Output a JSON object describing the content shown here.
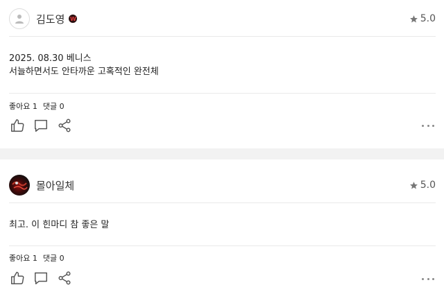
{
  "reviews": [
    {
      "username": "김도영",
      "badge": "W",
      "rating": "5.0",
      "body_lines": [
        "2025. 08.30 베니스",
        "서늘하면서도 안타까운 고혹적인 완전체"
      ],
      "likes_label": "좋아요 1",
      "comments_label": "댓글 0",
      "avatar": "default-user-icon"
    },
    {
      "username": "몰아일체",
      "rating": "5.0",
      "body_lines": [
        "최고. 이 힌마디 참 좋은 말"
      ],
      "likes_label": "좋아요 1",
      "comments_label": "댓글 0",
      "avatar": "photo"
    }
  ],
  "icons": {
    "star": "star-icon",
    "like": "thumbs-up-icon",
    "comment": "comment-icon",
    "share": "share-icon",
    "more": "more-icon"
  },
  "colors": {
    "star": "#777777",
    "icon": "#555555",
    "badge_bg": "#2a1010",
    "badge_fg": "#e03a3a"
  }
}
